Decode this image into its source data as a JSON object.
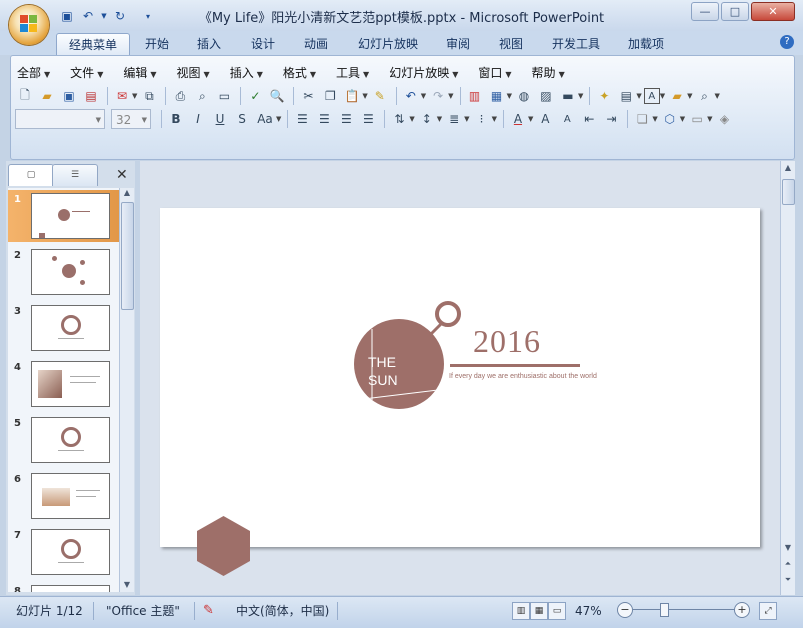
{
  "window": {
    "title": "《My Life》阳光小清新文艺范ppt模板.pptx - Microsoft PowerPoint",
    "minimize": "—",
    "maximize": "□",
    "close": "✕"
  },
  "ribbon_tabs": [
    "经典菜单",
    "开始",
    "插入",
    "设计",
    "动画",
    "幻灯片放映",
    "审阅",
    "视图",
    "开发工具",
    "加载项"
  ],
  "active_tab": "经典菜单",
  "classic_menu": [
    {
      "label": "全部"
    },
    {
      "label": "文件"
    },
    {
      "label": "编辑"
    },
    {
      "label": "视图"
    },
    {
      "label": "插入"
    },
    {
      "label": "格式"
    },
    {
      "label": "工具"
    },
    {
      "label": "幻灯片放映"
    },
    {
      "label": "窗口"
    },
    {
      "label": "帮助"
    }
  ],
  "font_name": "",
  "font_size": "32",
  "thumbnails": [
    {
      "num": "1"
    },
    {
      "num": "2"
    },
    {
      "num": "3"
    },
    {
      "num": "4"
    },
    {
      "num": "5"
    },
    {
      "num": "6"
    },
    {
      "num": "7"
    },
    {
      "num": "8"
    }
  ],
  "slide": {
    "circle_text_line1": "THE",
    "circle_text_line2": "SUN",
    "year": "2016",
    "tagline": "If every day we are enthusiastic about the world",
    "accent_color": "#9e6f69"
  },
  "status": {
    "slide_info": "幻灯片 1/12",
    "theme": "\"Office 主题\"",
    "language": "中文(简体，中国)",
    "zoom": "47%",
    "zoom_level": 0.3
  }
}
